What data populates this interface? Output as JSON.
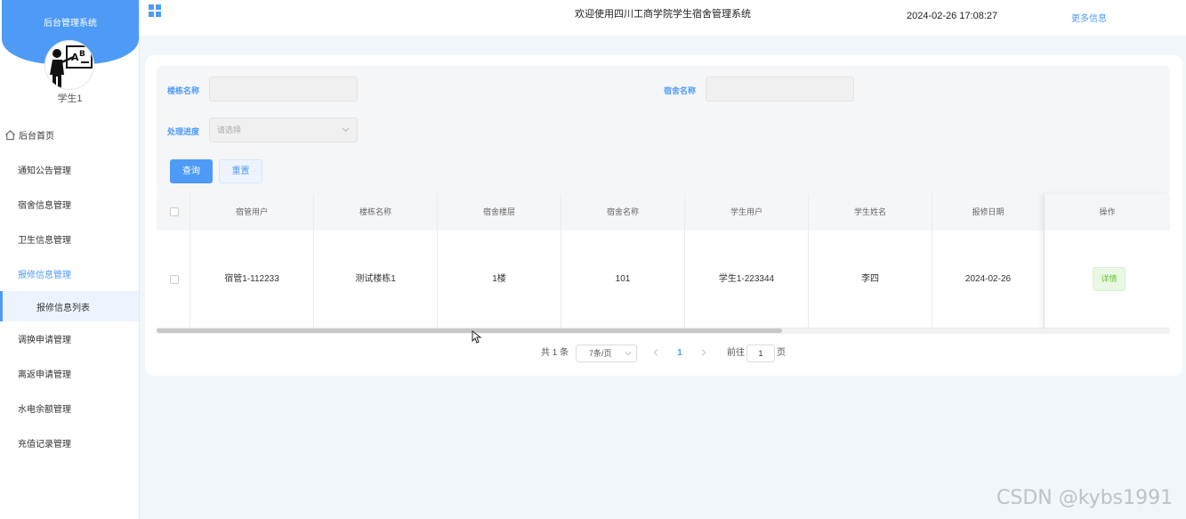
{
  "sidebar": {
    "brand_title": "后台管理系统",
    "user_name": "学生1",
    "home_label": "后台首页",
    "items": [
      {
        "label": "通知公告管理"
      },
      {
        "label": "宿舍信息管理"
      },
      {
        "label": "卫生信息管理"
      },
      {
        "label": "报修信息管理"
      }
    ],
    "sub_item": "报修信息列表",
    "items_after": [
      {
        "label": "调换申请管理"
      },
      {
        "label": "离返申请管理"
      },
      {
        "label": "水电余额管理"
      },
      {
        "label": "充值记录管理"
      }
    ],
    "accent_color": "#4d9bf6"
  },
  "header": {
    "welcome": "欢迎使用四川工商学院学生宿舍管理系统",
    "datetime": "2024-02-26 17:08:27",
    "more": "更多信息"
  },
  "filter": {
    "building_label": "楼栋名称",
    "building_value": "",
    "dorm_label": "宿舍名称",
    "dorm_value": "",
    "status_label": "处理进度",
    "status_placeholder": "请选择",
    "query_button": "查询",
    "reset_button": "重置"
  },
  "table": {
    "columns": [
      "宿管用户",
      "楼栋名称",
      "宿舍楼层",
      "宿舍名称",
      "学生用户",
      "学生姓名",
      "报修日期",
      "操作"
    ],
    "rows": [
      {
        "dorm_admin": "宿管1-112233",
        "building": "测试楼栋1",
        "floor": "1楼",
        "dorm": "101",
        "student_user": "学生1-223344",
        "student_name": "李四",
        "date": "2024-02-26",
        "action": "详情"
      }
    ]
  },
  "pagination": {
    "total": "共 1 条",
    "page_size": "7条/页",
    "current": "1",
    "goto_prefix": "前往",
    "goto_value": "1",
    "goto_suffix": "页"
  },
  "watermark": "CSDN @kybs1991"
}
